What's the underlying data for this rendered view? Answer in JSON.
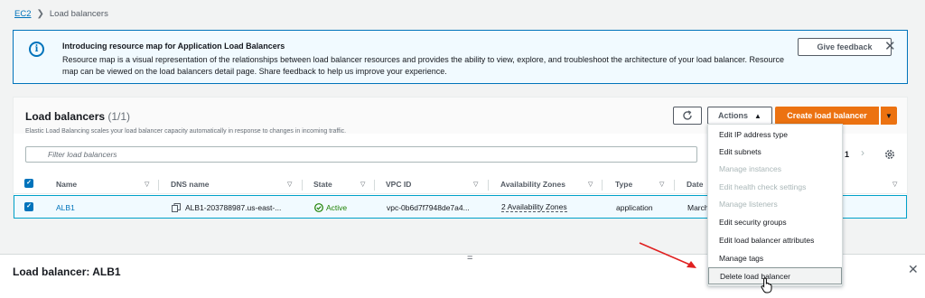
{
  "breadcrumb": {
    "parent": "EC2",
    "current": "Load balancers"
  },
  "banner": {
    "title": "Introducing resource map for Application Load Balancers",
    "body": "Resource map is a visual representation of the relationships between load balancer resources and provides the ability to view, explore, and troubleshoot the architecture of your load balancer. Resource map can be viewed on the load balancers detail page. Share feedback to help us improve your experience.",
    "feedback_label": "Give feedback"
  },
  "panel": {
    "title": "Load balancers",
    "count": "(1/1)",
    "subtitle": "Elastic Load Balancing scales your load balancer capacity automatically in response to changes in incoming traffic.",
    "actions_label": "Actions",
    "create_label": "Create load balancer",
    "filter_placeholder": "Filter load balancers",
    "page_number": "1"
  },
  "table": {
    "columns": [
      "Name",
      "DNS name",
      "State",
      "VPC ID",
      "Availability Zones",
      "Type",
      "Date"
    ],
    "rows": [
      {
        "name": "ALB1",
        "dns": "ALB1-203788987.us-east-...",
        "state": "Active",
        "vpc": "vpc-0b6d7f7948de7a4...",
        "az": "2 Availability Zones",
        "type": "application",
        "date": "March"
      }
    ]
  },
  "dropdown": {
    "items": [
      {
        "label": "Edit IP address type",
        "enabled": true
      },
      {
        "label": "Edit subnets",
        "enabled": true
      },
      {
        "label": "Manage instances",
        "enabled": false
      },
      {
        "label": "Edit health check settings",
        "enabled": false
      },
      {
        "label": "Manage listeners",
        "enabled": false
      },
      {
        "label": "Edit security groups",
        "enabled": true
      },
      {
        "label": "Edit load balancer attributes",
        "enabled": true
      },
      {
        "label": "Manage tags",
        "enabled": true
      },
      {
        "label": "Delete load balancer",
        "enabled": true,
        "hovered": true
      }
    ]
  },
  "detail": {
    "title": "Load balancer: ALB1",
    "drag_glyph": "="
  },
  "colors": {
    "accent": "#0073bb",
    "primary_button": "#ec7211",
    "active_status": "#1d8102",
    "annotation_arrow": "#e02020"
  },
  "icons": [
    "info-icon",
    "close-icon",
    "refresh-icon",
    "caret-up-icon",
    "caret-down-icon",
    "search-icon",
    "chevron-right-icon",
    "gear-icon",
    "copy-icon",
    "check-circle-icon",
    "sort-icon",
    "checkbox-icon",
    "pointer-cursor-icon",
    "red-arrow-annotation"
  ]
}
